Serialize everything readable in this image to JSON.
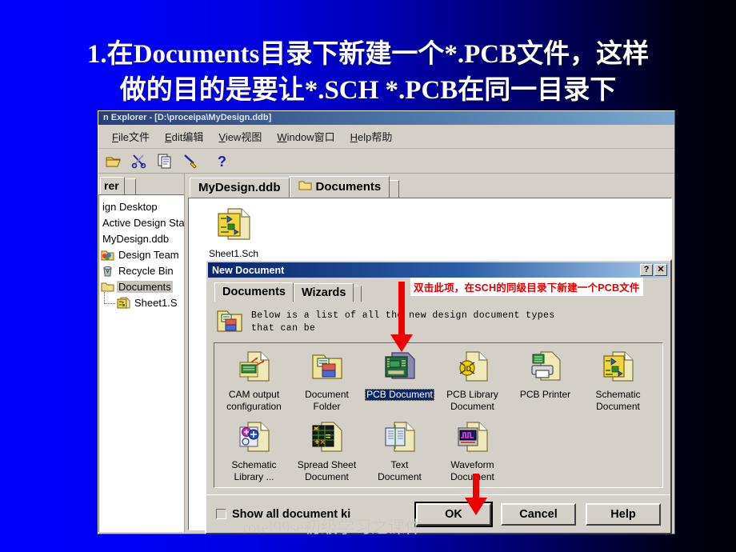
{
  "slide": {
    "title_line1": "1.在Documents目录下新建一个*.PCB文件，这样",
    "title_line2": "做的目的是要让*.SCH *.PCB在同一目录下",
    "watermark": "rotel99se初级学习之课件"
  },
  "explorer": {
    "titlebar": "n Explorer - [D:\\proceipa\\MyDesign.ddb]",
    "menu": [
      {
        "label": "File文件",
        "accel": "F"
      },
      {
        "label": "Edit编辑",
        "accel": "E"
      },
      {
        "label": "View视图",
        "accel": "V"
      },
      {
        "label": "Window窗口",
        "accel": "W"
      },
      {
        "label": "Help帮助",
        "accel": "H"
      }
    ],
    "toolbar": [
      {
        "icon": "open-folder-icon"
      },
      {
        "icon": "cut-scissors-icon"
      },
      {
        "icon": "copy-icon"
      },
      {
        "icon": "paste-brush-icon"
      },
      {
        "icon": "help-question-icon"
      }
    ],
    "tree": {
      "tab_label": "rer",
      "items": [
        {
          "label": "ign Desktop",
          "icon": "none",
          "selected": false,
          "indent": 0
        },
        {
          "label": "Active Design Sta",
          "icon": "none",
          "selected": false,
          "indent": 0
        },
        {
          "label": "MyDesign.ddb",
          "icon": "none",
          "selected": false,
          "indent": 0
        },
        {
          "label": "Design Team",
          "icon": "design-team-icon",
          "selected": false,
          "indent": 0
        },
        {
          "label": "Recycle Bin",
          "icon": "recycle-bin-icon",
          "selected": false,
          "indent": 0
        },
        {
          "label": "Documents",
          "icon": "folder-icon",
          "selected": true,
          "indent": 0
        },
        {
          "label": "Sheet1.S",
          "icon": "schematic-icon",
          "selected": false,
          "indent": 1
        }
      ]
    },
    "doc_tabs": [
      {
        "label": "MyDesign.ddb",
        "icon": "none",
        "active": false
      },
      {
        "label": "Documents",
        "icon": "folder-icon",
        "active": true
      }
    ],
    "doc_files": [
      {
        "name": "Sheet1.Sch",
        "icon": "schematic-icon"
      }
    ]
  },
  "dialog": {
    "title": "New Document",
    "sys_help": "?",
    "sys_close": "✕",
    "tabs": [
      {
        "label": "Documents",
        "active": true
      },
      {
        "label": "Wizards",
        "active": false
      }
    ],
    "description": "Below is a list of all the new design document types\nthat can be",
    "description_icon": "document-folder-icon",
    "doc_types": [
      {
        "label": "CAM output\nconfiguration",
        "icon": "cam-output-icon",
        "selected": false
      },
      {
        "label": "Document\nFolder",
        "icon": "document-folder-icon",
        "selected": false
      },
      {
        "label": "PCB Document",
        "icon": "pcb-document-icon",
        "selected": true
      },
      {
        "label": "PCB Library\nDocument",
        "icon": "pcb-library-icon",
        "selected": false
      },
      {
        "label": "PCB Printer",
        "icon": "pcb-printer-icon",
        "selected": false
      },
      {
        "label": "Schematic\nDocument",
        "icon": "schematic-doc-icon",
        "selected": false
      },
      {
        "label": "Schematic\nLibrary ...",
        "icon": "schematic-library-icon",
        "selected": false
      },
      {
        "label": "Spread Sheet\nDocument",
        "icon": "spreadsheet-icon",
        "selected": false
      },
      {
        "label": "Text\nDocument",
        "icon": "text-document-icon",
        "selected": false
      },
      {
        "label": "Waveform\nDocument",
        "icon": "waveform-icon",
        "selected": false
      }
    ],
    "show_all_label": "Show all document ki",
    "show_all_checked": false,
    "buttons": [
      {
        "label": "OK",
        "default": true
      },
      {
        "label": "Cancel",
        "default": false
      },
      {
        "label": "Help",
        "default": false
      }
    ]
  },
  "annotations": {
    "note": "双击此项，在SCH的同级目录下新建一个PCB文件",
    "note_color": "#e00000",
    "arrows": [
      {
        "name": "arrow-to-pcb-document"
      },
      {
        "name": "arrow-to-ok-button"
      }
    ]
  }
}
